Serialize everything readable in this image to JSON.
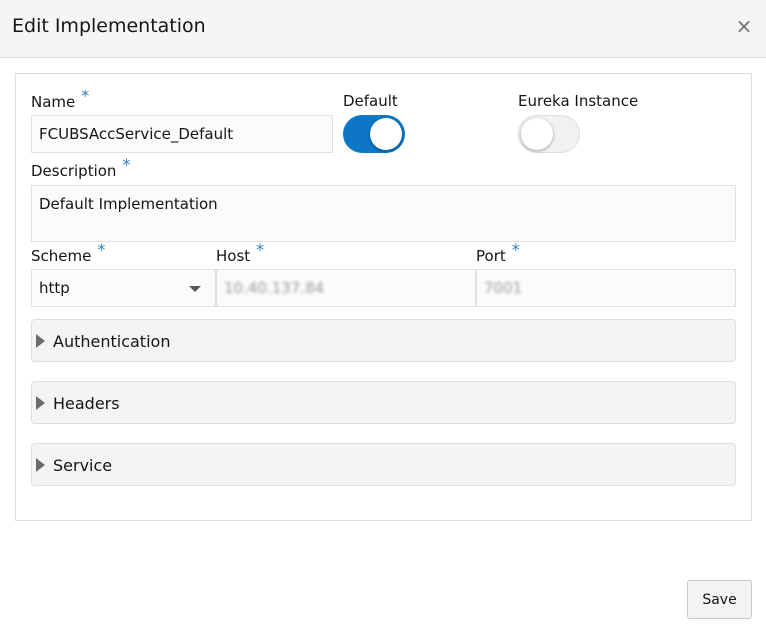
{
  "dialog": {
    "title": "Edit Implementation",
    "close_glyph": "×"
  },
  "form": {
    "name": {
      "label": "Name",
      "required": "*",
      "value": "FCUBSAccService_Default"
    },
    "default": {
      "label": "Default",
      "checked": true
    },
    "eureka": {
      "label": "Eureka Instance",
      "checked": false
    },
    "description": {
      "label": "Description",
      "required": "*",
      "value": "Default Implementation"
    },
    "scheme": {
      "label": "Scheme",
      "required": "*",
      "value": "http"
    },
    "host": {
      "label": "Host",
      "required": "*",
      "value": "10.40.137.84"
    },
    "port": {
      "label": "Port",
      "required": "*",
      "value": "7001"
    }
  },
  "sections": [
    {
      "label": "Authentication"
    },
    {
      "label": "Headers"
    },
    {
      "label": "Service"
    }
  ],
  "footer": {
    "save_label": "Save"
  },
  "colors": {
    "accent": "#0d76c5",
    "required": "#2d7fc3"
  }
}
